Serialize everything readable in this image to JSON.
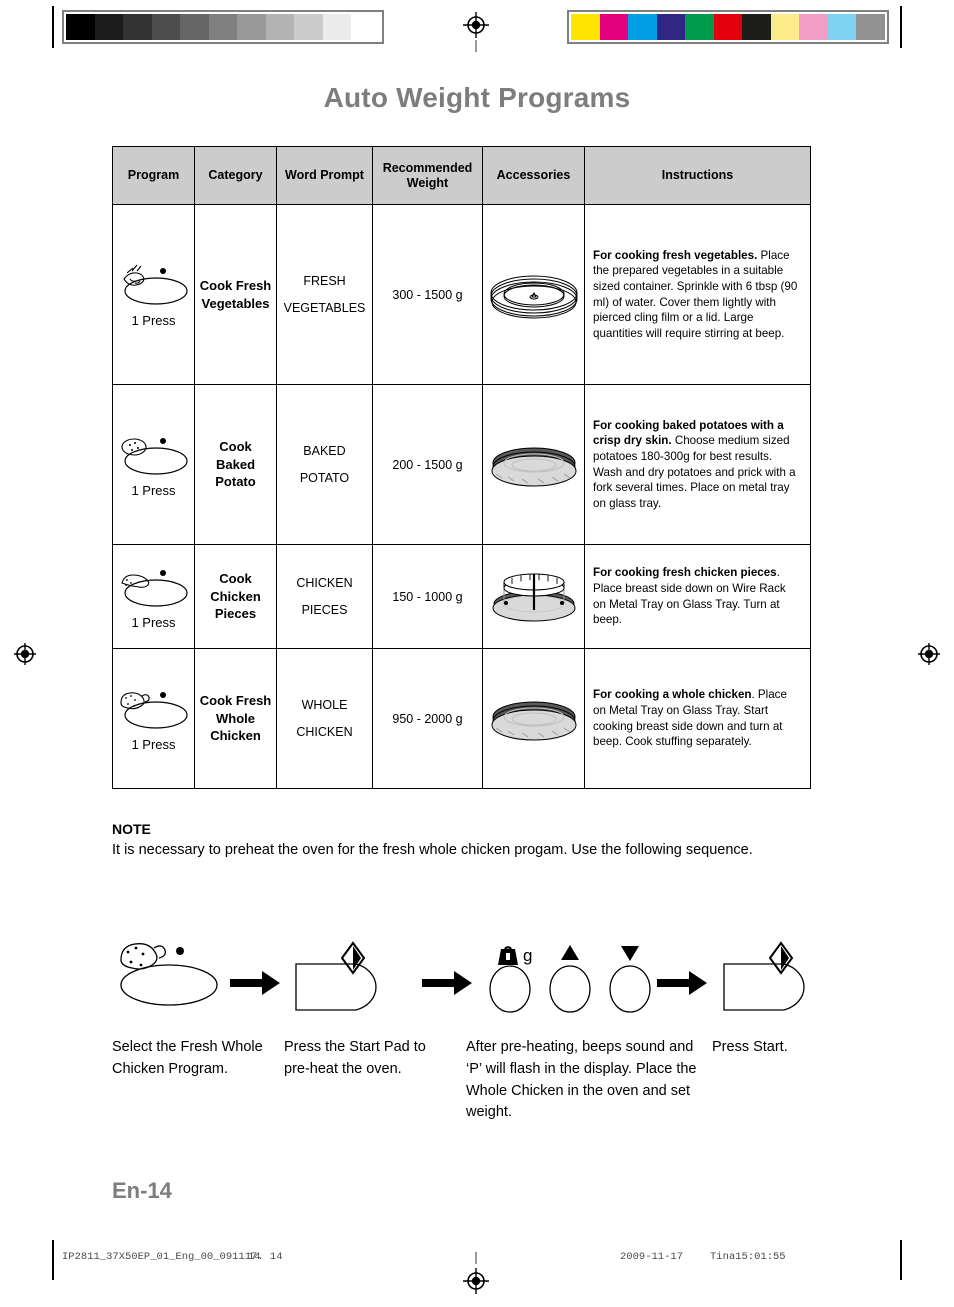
{
  "page": {
    "title": "Auto Weight Programs",
    "page_number": "En-14"
  },
  "print_marks": {
    "gray_bar": [
      "#000000",
      "#1c1c1c",
      "#333333",
      "#4d4d4d",
      "#666666",
      "#808080",
      "#999999",
      "#b3b3b3",
      "#cccccc",
      "#ebebeb",
      "#ffffff"
    ],
    "color_bar": [
      "#ffe500",
      "#e5007e",
      "#009fe3",
      "#312783",
      "#009b4b",
      "#e3000f",
      "#1d1d1b",
      "#fbeb8b",
      "#f29ec4",
      "#7fd3f2",
      "#919191"
    ]
  },
  "table": {
    "headers": [
      "Program",
      "Category",
      "Word Prompt",
      "Recommended Weight",
      "Accessories",
      "Instructions"
    ],
    "rows": [
      {
        "program_icon": "cook-fresh-vegetables-pad-icon",
        "press_label": "1 Press",
        "category": "Cook Fresh Vegetables",
        "word_prompt_line1": "FRESH",
        "word_prompt_line2": "VEGETABLES",
        "weight": "300 - 1500 g",
        "accessory_icon": "glass-tray-icon",
        "instruction_bold": "For cooking fresh vegetables.",
        "instruction_text": " Place the prepared vegetables in a suitable sized container. Sprinkle with 6 tbsp (90 ml) of water. Cover them lightly with pierced cling film or a lid. Large quantities will require stirring at beep."
      },
      {
        "program_icon": "cook-baked-potato-pad-icon",
        "press_label": "1 Press",
        "category": "Cook Baked Potato",
        "word_prompt_line1": "BAKED",
        "word_prompt_line2": "POTATO",
        "weight": "200 - 1500 g",
        "accessory_icon": "metal-tray-icon",
        "instruction_bold": "For cooking baked potatoes with a crisp dry skin.",
        "instruction_text": " Choose medium sized potatoes 180-300g for best results. Wash and dry potatoes and prick with a fork several times. Place on metal tray on glass tray."
      },
      {
        "program_icon": "cook-chicken-pieces-pad-icon",
        "press_label": "1 Press",
        "category": "Cook Chicken Pieces",
        "word_prompt_line1": "CHICKEN",
        "word_prompt_line2": "PIECES",
        "weight": "150 - 1000 g",
        "accessory_icon": "wire-rack-on-metal-tray-icon",
        "instruction_bold": "For cooking fresh chicken pieces",
        "instruction_text": ". Place breast side down on Wire Rack on Metal Tray on Glass Tray. Turn at beep."
      },
      {
        "program_icon": "cook-fresh-whole-chicken-pad-icon",
        "press_label": "1 Press",
        "category": "Cook Fresh Whole Chicken",
        "word_prompt_line1": "WHOLE",
        "word_prompt_line2": "CHICKEN",
        "weight": "950 - 2000 g",
        "accessory_icon": "metal-tray-icon",
        "instruction_bold": "For cooking a whole chicken",
        "instruction_text": ". Place on Metal Tray on Glass Tray. Start cooking breast side down and turn at beep. Cook stuffing separately."
      }
    ]
  },
  "note": {
    "title": "NOTE",
    "text": "It is necessary to preheat the oven for the fresh whole chicken progam. Use the following sequence."
  },
  "sequence": {
    "steps": [
      {
        "icon": "whole-chicken-pad-icon",
        "caption": "Select the Fresh Whole Chicken Program."
      },
      {
        "icon": "start-pad-icon",
        "caption": "Press the Start Pad to pre-heat the oven."
      },
      {
        "icon": "weight-up-down-pads-icon",
        "caption": "After pre-heating, beeps sound and ‘P’ will flash in the display. Place the Whole Chicken in the oven and set weight."
      },
      {
        "icon": "start-pad-icon",
        "caption": "Press Start."
      }
    ],
    "weight_pad_label": "g"
  },
  "footer": {
    "file": "IP2811_37X50EP_01_Eng_00_091117. 14",
    "page": "14",
    "date": "2009-11-17",
    "user": "Tina15:01:55"
  }
}
